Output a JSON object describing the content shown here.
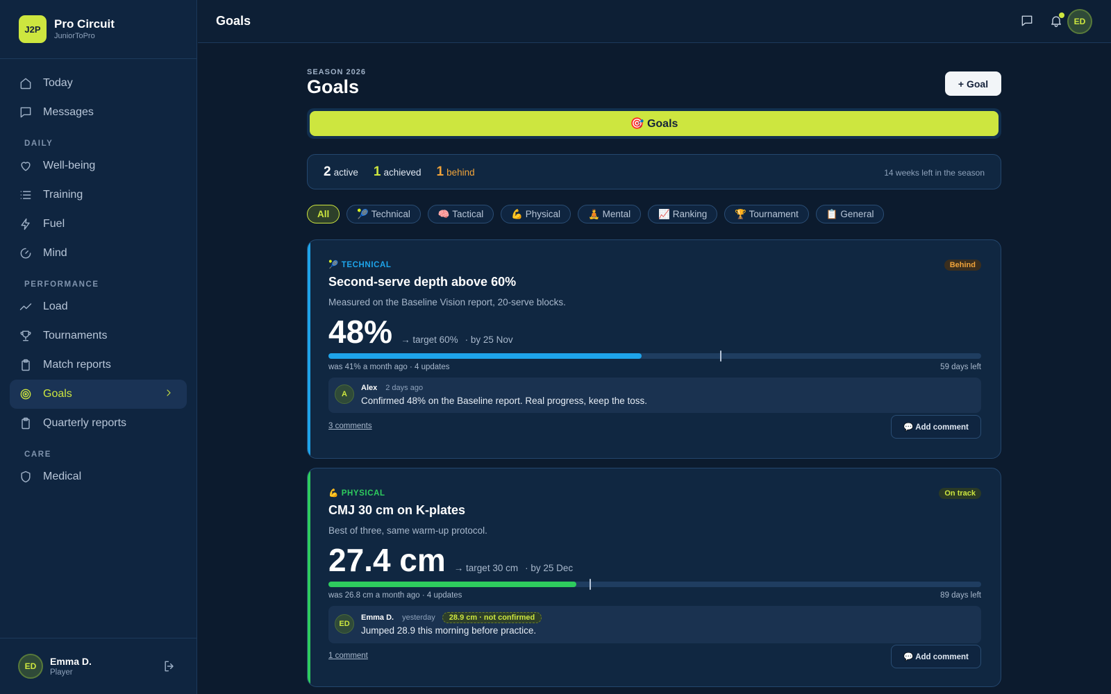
{
  "brand": {
    "logo": "J2P",
    "name": "Pro Circuit",
    "sub": "JuniorToPro"
  },
  "nav": {
    "today": "Today",
    "messages": "Messages",
    "section_daily": "DAILY",
    "wellbeing": "Well-being",
    "training": "Training",
    "fuel": "Fuel",
    "mind": "Mind",
    "section_performance": "PERFORMANCE",
    "load": "Load",
    "tournaments": "Tournaments",
    "match_reports": "Match reports",
    "goals": "Goals",
    "quarterly_reports": "Quarterly reports",
    "section_care": "CARE",
    "medical": "Medical"
  },
  "user": {
    "initials": "ED",
    "name": "Emma D.",
    "role": "Player"
  },
  "topbar": {
    "title": "Goals"
  },
  "page": {
    "season": "SEASON 2026",
    "title": "Goals",
    "add_goal": "+ Goal",
    "tab": "🎯 Goals"
  },
  "summary": {
    "active_n": "2",
    "active_t": "active",
    "achieved_n": "1",
    "achieved_t": "achieved",
    "behind_n": "1",
    "behind_t": "behind",
    "weeks_left": "14 weeks left in the season"
  },
  "filters": {
    "all": "All",
    "technical": "🎾 Technical",
    "tactical": "🧠 Tactical",
    "physical": "💪 Physical",
    "mental": "🧘 Mental",
    "ranking": "📈 Ranking",
    "tournament": "🏆 Tournament",
    "general": "📋 General"
  },
  "goals": [
    {
      "category": "🎾 TECHNICAL",
      "status": "Behind",
      "title": "Second-serve depth above 60%",
      "description": "Measured on the Baseline Vision report, 20-serve blocks.",
      "value": "48%",
      "target": "→ target 60%",
      "by": "· by 25 Nov",
      "progress": 0.48,
      "target_fraction": 0.6,
      "history": "was 41% a month ago · 4 updates",
      "days_left": "59 days left",
      "comment": {
        "initials": "A",
        "author": "Alex",
        "time": "2 days ago",
        "text": "Confirmed 48% on the Baseline report. Real progress, keep the toss."
      },
      "comments_link": "3 comments",
      "add_comment": "💬 Add comment",
      "color": "#1ea4ea"
    },
    {
      "category": "💪 PHYSICAL",
      "status": "On track",
      "title": "CMJ 30 cm on K-plates",
      "description": "Best of three, same warm-up protocol.",
      "value": "27.4 cm",
      "target": "→ target 30 cm",
      "by": "· by 25 Dec",
      "progress": 0.38,
      "target_fraction": 0.4,
      "history": "was 26.8 cm a month ago · 4 updates",
      "days_left": "89 days left",
      "comment": {
        "initials": "ED",
        "author": "Emma D.",
        "time": "yesterday",
        "badge": "28.9 cm · not confirmed",
        "text": "Jumped 28.9 this morning before practice."
      },
      "comments_link": "1 comment",
      "add_comment": "💬 Add comment",
      "color": "#2ecc5e"
    }
  ]
}
